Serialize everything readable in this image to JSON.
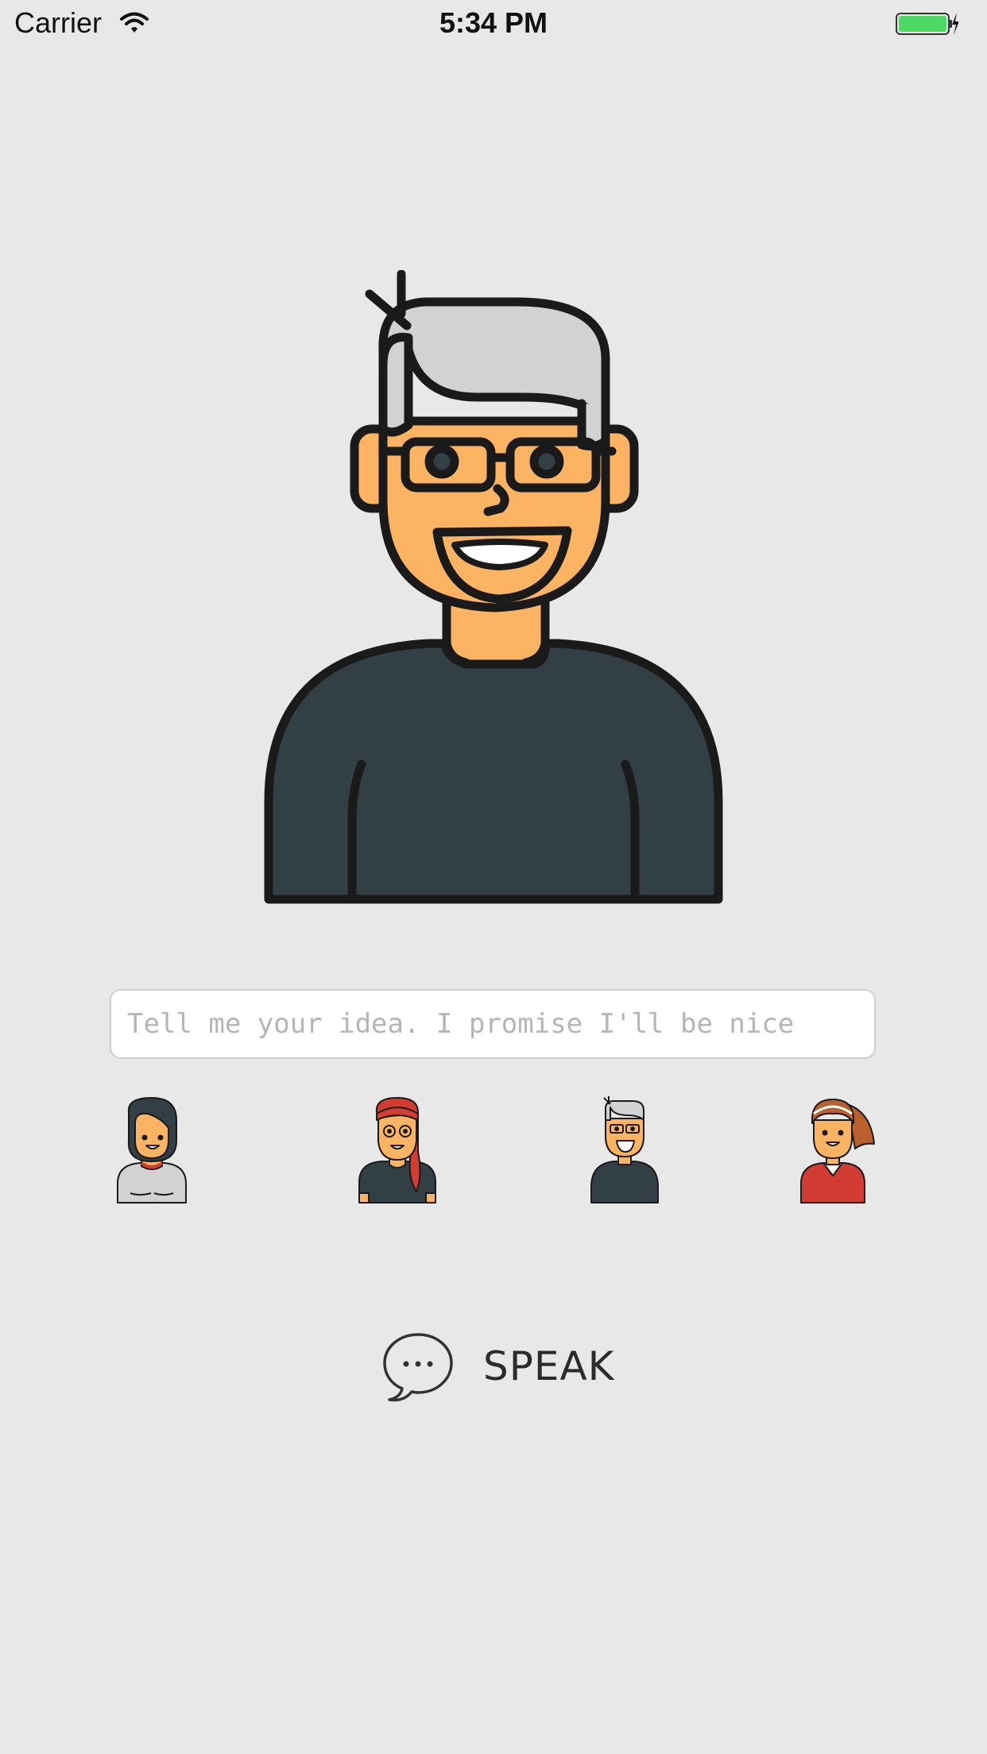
{
  "status_bar": {
    "carrier": "Carrier",
    "time": "5:34 PM",
    "battery_color": "#4cd964"
  },
  "main_avatar": {
    "name": "grey-haired-man-avatar"
  },
  "idea_input": {
    "value": "",
    "placeholder": "Tell me your idea. I promise I'll be nice"
  },
  "avatar_options": [
    {
      "icon": "short-hair-woman-avatar-icon"
    },
    {
      "icon": "redhead-glasses-woman-avatar-icon"
    },
    {
      "icon": "grey-haired-man-avatar-icon"
    },
    {
      "icon": "ponytail-woman-avatar-icon"
    }
  ],
  "speak_button": {
    "label": "SPEAK",
    "icon": "chat-bubble-icon"
  },
  "colors": {
    "background": "#e9e8e9",
    "skin": "#fdb462",
    "shirt_dark": "#323f45",
    "hair_grey": "#d2d2d2",
    "outline": "#1a1a1a",
    "red": "#d23c33",
    "brown_hair": "#b9602d"
  }
}
